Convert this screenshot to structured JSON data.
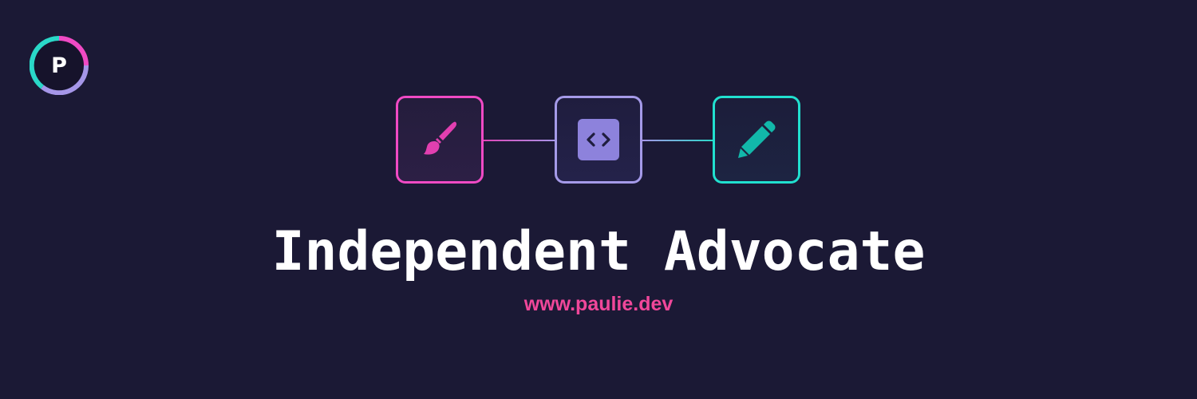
{
  "logo": {
    "letter": "P",
    "ring_colors": [
      "#f04ac4",
      "#a596e8",
      "#2ad8c8"
    ]
  },
  "pipeline": {
    "steps": [
      {
        "icon": "paintbrush-icon",
        "color": "#e23fb0"
      },
      {
        "icon": "code-icon",
        "color": "#8d82dc"
      },
      {
        "icon": "pencil-icon",
        "color": "#12b8aa"
      }
    ]
  },
  "headline": {
    "title": "Independent Advocate",
    "url": "www.paulie.dev"
  },
  "colors": {
    "background": "#1b1935",
    "title": "#ffffff",
    "url": "#f0479a"
  }
}
